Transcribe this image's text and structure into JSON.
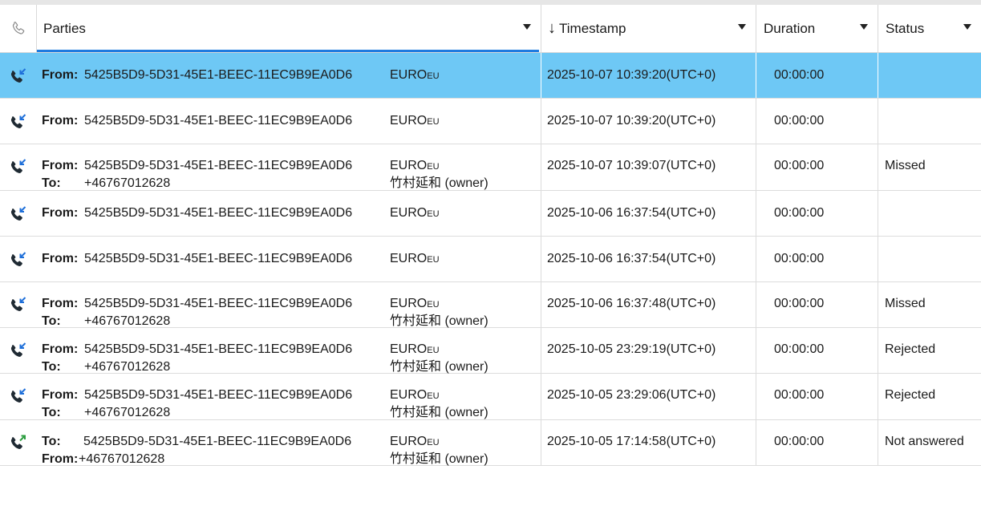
{
  "header": {
    "parties_label": "Parties",
    "timestamp_label": "Timestamp",
    "timestamp_sort_arrow": "↓",
    "duration_label": "Duration",
    "status_label": "Status",
    "phone_icon": "phone-outline-icon"
  },
  "colors": {
    "selected_row": "#6ec8f5",
    "sort_underline": "#1e7be0",
    "incoming_icon": "#1e6fd9",
    "outgoing_icon": "#2c9d3f"
  },
  "rows": [
    {
      "direction": "incoming",
      "line1_label": "From:",
      "line1_value": "5425B5D9-5D31-45E1-BEEC-11EC9B9EA0D6",
      "party1_main": "EURO",
      "party1_sub": "EU",
      "line2_label": "",
      "line2_value": "",
      "party2": "",
      "timestamp": "2025-10-07 10:39:20(UTC+0)",
      "duration": "00:00:00",
      "status": "",
      "selected": true
    },
    {
      "direction": "incoming",
      "line1_label": "From:",
      "line1_value": "5425B5D9-5D31-45E1-BEEC-11EC9B9EA0D6",
      "party1_main": "EURO",
      "party1_sub": "EU",
      "line2_label": "",
      "line2_value": "",
      "party2": "",
      "timestamp": "2025-10-07 10:39:20(UTC+0)",
      "duration": "00:00:00",
      "status": "",
      "selected": false
    },
    {
      "direction": "incoming",
      "line1_label": "From:",
      "line1_value": "5425B5D9-5D31-45E1-BEEC-11EC9B9EA0D6",
      "party1_main": "EURO",
      "party1_sub": "EU",
      "line2_label": "To:",
      "line2_value": "+46767012628",
      "party2": "竹村延和 (owner)",
      "timestamp": "2025-10-07 10:39:07(UTC+0)",
      "duration": "00:00:00",
      "status": "Missed",
      "selected": false
    },
    {
      "direction": "incoming",
      "line1_label": "From:",
      "line1_value": "5425B5D9-5D31-45E1-BEEC-11EC9B9EA0D6",
      "party1_main": "EURO",
      "party1_sub": "EU",
      "line2_label": "",
      "line2_value": "",
      "party2": "",
      "timestamp": "2025-10-06 16:37:54(UTC+0)",
      "duration": "00:00:00",
      "status": "",
      "selected": false
    },
    {
      "direction": "incoming",
      "line1_label": "From:",
      "line1_value": "5425B5D9-5D31-45E1-BEEC-11EC9B9EA0D6",
      "party1_main": "EURO",
      "party1_sub": "EU",
      "line2_label": "",
      "line2_value": "",
      "party2": "",
      "timestamp": "2025-10-06 16:37:54(UTC+0)",
      "duration": "00:00:00",
      "status": "",
      "selected": false
    },
    {
      "direction": "incoming",
      "line1_label": "From:",
      "line1_value": "5425B5D9-5D31-45E1-BEEC-11EC9B9EA0D6",
      "party1_main": "EURO",
      "party1_sub": "EU",
      "line2_label": "To:",
      "line2_value": "+46767012628",
      "party2": "竹村延和 (owner)",
      "timestamp": "2025-10-06 16:37:48(UTC+0)",
      "duration": "00:00:00",
      "status": "Missed",
      "selected": false
    },
    {
      "direction": "incoming",
      "line1_label": "From:",
      "line1_value": "5425B5D9-5D31-45E1-BEEC-11EC9B9EA0D6",
      "party1_main": "EURO",
      "party1_sub": "EU",
      "line2_label": "To:",
      "line2_value": "+46767012628",
      "party2": "竹村延和 (owner)",
      "timestamp": "2025-10-05 23:29:19(UTC+0)",
      "duration": "00:00:00",
      "status": "Rejected",
      "selected": false
    },
    {
      "direction": "incoming",
      "line1_label": "From:",
      "line1_value": "5425B5D9-5D31-45E1-BEEC-11EC9B9EA0D6",
      "party1_main": "EURO",
      "party1_sub": "EU",
      "line2_label": "To:",
      "line2_value": "+46767012628",
      "party2": "竹村延和 (owner)",
      "timestamp": "2025-10-05 23:29:06(UTC+0)",
      "duration": "00:00:00",
      "status": "Rejected",
      "selected": false
    },
    {
      "direction": "outgoing",
      "line1_label": "To:",
      "line1_value": "5425B5D9-5D31-45E1-BEEC-11EC9B9EA0D6",
      "party1_main": "EURO",
      "party1_sub": "EU",
      "line2_label": "From:",
      "line2_value": "+46767012628",
      "party2": "竹村延和 (owner)",
      "timestamp": "2025-10-05 17:14:58(UTC+0)",
      "duration": "00:00:00",
      "status": "Not answered",
      "selected": false
    }
  ]
}
